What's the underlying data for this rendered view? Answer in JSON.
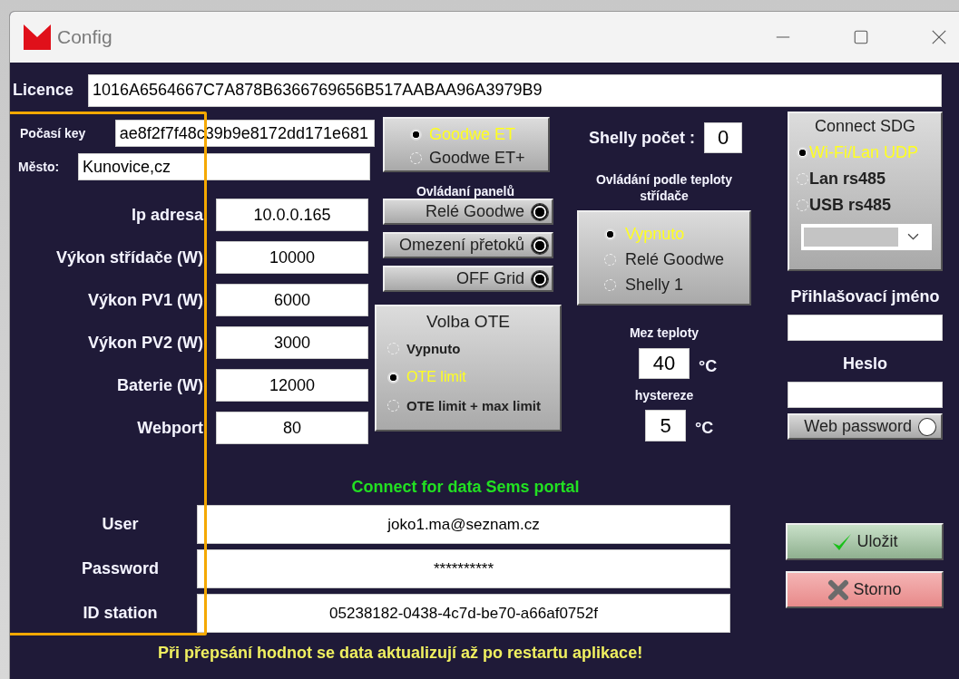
{
  "window": {
    "title": "Config"
  },
  "licence": {
    "label": "Licence",
    "value": "1016A6564667C7A878B6366769656B517AABAA96A3979B9"
  },
  "weather": {
    "key_label": "Počasí key",
    "key_value": "ae8f2f7f48c39b9e8172dd171e681",
    "city_label": "Město:",
    "city_value": "Kunovice,cz"
  },
  "settings": [
    {
      "label": "Ip adresa",
      "value": "10.0.0.165"
    },
    {
      "label": "Výkon střídače (W)",
      "value": "10000"
    },
    {
      "label": "Výkon PV1 (W)",
      "value": "6000"
    },
    {
      "label": "Výkon PV2 (W)",
      "value": "3000"
    },
    {
      "label": "Baterie (W)",
      "value": "12000"
    },
    {
      "label": "Webport",
      "value": "80"
    }
  ],
  "inverter_type": {
    "options": [
      {
        "label": "Goodwe ET",
        "selected": true
      },
      {
        "label": "Goodwe ET+",
        "selected": false
      }
    ]
  },
  "panel_control": {
    "title": "Ovládaní  panelů",
    "toggles": [
      {
        "label": "Relé Goodwe",
        "on": true
      },
      {
        "label": "Omezení přetoků",
        "on": true
      },
      {
        "label": "OFF Grid",
        "on": true
      }
    ]
  },
  "ote": {
    "title": "Volba OTE",
    "options": [
      {
        "label": "Vypnuto",
        "selected": false
      },
      {
        "label": "OTE limit",
        "selected": true
      },
      {
        "label": "OTE limit + max limit",
        "selected": false
      }
    ]
  },
  "shelly": {
    "label": "Shelly počet :",
    "value": "0"
  },
  "temp_control": {
    "title": "Ovládání podle teploty střídače",
    "options": [
      {
        "label": "Vypnuto",
        "selected": true
      },
      {
        "label": "Relé Goodwe",
        "selected": false
      },
      {
        "label": "Shelly 1",
        "selected": false
      }
    ],
    "limit_label": "Mez teploty",
    "limit_value": "40",
    "limit_unit": "°C",
    "hysteresis_label": "hystereze",
    "hysteresis_value": "5",
    "hysteresis_unit": "°C"
  },
  "sdg": {
    "title": "Connect SDG",
    "options": [
      {
        "label": "Wi-Fi/Lan UDP",
        "selected": true
      },
      {
        "label": "Lan rs485",
        "selected": false
      },
      {
        "label": "USB rs485",
        "selected": false
      }
    ]
  },
  "login": {
    "username_label": "Přihlašovací jméno",
    "password_label": "Heslo",
    "web_password": {
      "label": "Web password",
      "on": false
    }
  },
  "sems": {
    "title": "Connect for data Sems portal",
    "fields": [
      {
        "label": "User",
        "value": "joko1.ma@seznam.cz"
      },
      {
        "label": "Password",
        "value": "**********"
      },
      {
        "label": "ID station",
        "value": "05238182-0438-4c7d-be70-a66af0752f"
      }
    ]
  },
  "buttons": [
    {
      "label": "Uložit",
      "kind": "save"
    },
    {
      "label": "Storno",
      "kind": "cancel"
    }
  ],
  "warning": "Při přepsání hodnot se data aktualizují až po restartu aplikace!"
}
